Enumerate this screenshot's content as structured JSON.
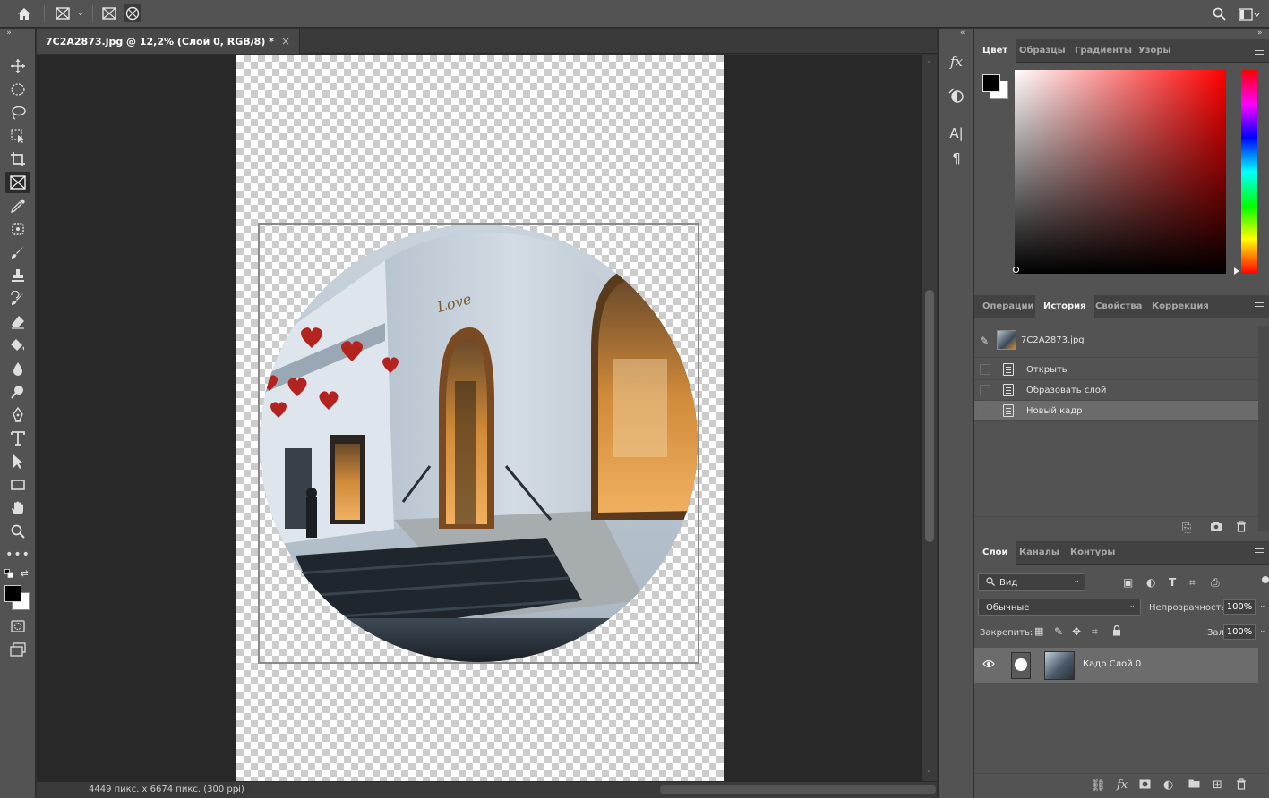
{
  "optbar": {
    "icons": [
      "home-icon",
      "frame-tool-icon",
      "chevron-down-icon",
      "frame-rect-icon",
      "frame-ellipse-icon",
      "search-icon",
      "workspace-icon"
    ]
  },
  "document": {
    "tab_title": "7C2A2873.jpg @ 12,2% (Слой 0, RGB/8) *",
    "close_label": "×",
    "status": "4449 пикс. x 6674 пикс. (300 ppi)",
    "status_arrow": "›"
  },
  "colors": {
    "foreground": "#000000",
    "background": "#ffffff",
    "panel_bg": "#535353",
    "canvas_bg": "#282828"
  },
  "color_panel": {
    "tabs": [
      "Цвет",
      "Образцы",
      "Градиенты",
      "Узоры"
    ]
  },
  "history_panel": {
    "tabs": [
      "Операции",
      "История",
      "Свойства",
      "Коррекция"
    ],
    "snapshot": "7C2A2873.jpg",
    "items": [
      {
        "label": "Открыть"
      },
      {
        "label": "Образовать слой"
      },
      {
        "label": "Новый кадр"
      }
    ]
  },
  "layers_panel": {
    "tabs": [
      "Слои",
      "Каналы",
      "Контуры"
    ],
    "filter_placeholder": "Вид",
    "blend_mode": "Обычные",
    "opacity_label": "Непрозрачность:",
    "opacity_value": "100%",
    "lock_label": "Закрепить:",
    "fill_label": "Заливка:",
    "fill_value": "100%",
    "layer_name": "Кадр Слой 0"
  },
  "iconpanel": {
    "fx_label": "fx",
    "type_label": "A|",
    "para_label": "¶"
  }
}
